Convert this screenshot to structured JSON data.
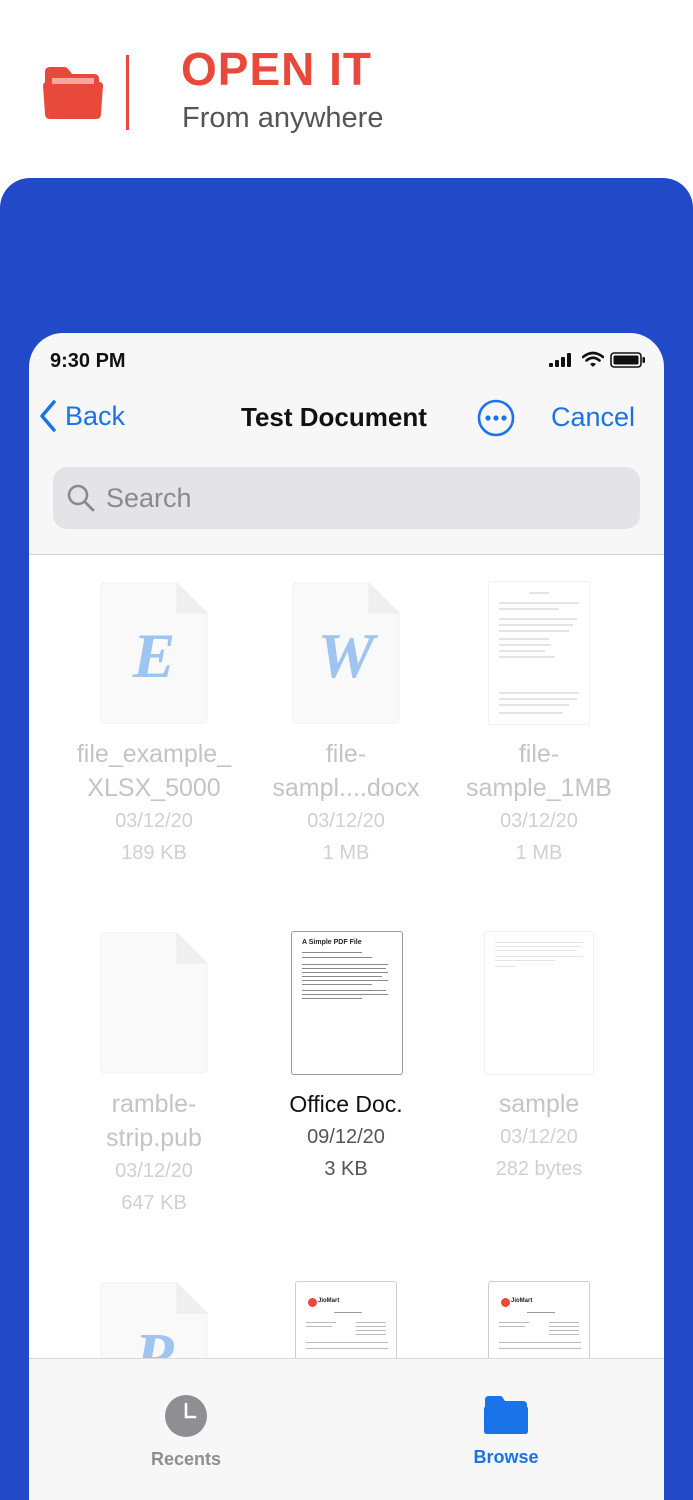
{
  "promo": {
    "headline": "OPEN IT",
    "subline": "From anywhere",
    "accent_color": "#e8493b",
    "panel_color": "#2249c8"
  },
  "status_bar": {
    "time": "9:30 PM",
    "icons": [
      "signal-icon",
      "wifi-icon",
      "battery-icon"
    ]
  },
  "nav": {
    "back_label": "Back",
    "title": "Test Document",
    "more_icon": "ellipsis-circle-icon",
    "cancel_label": "Cancel",
    "link_color": "#1a73e8"
  },
  "search": {
    "placeholder": "Search",
    "value": ""
  },
  "files": [
    {
      "name_line1": "file_example_",
      "name_line2": "XLSX_5000",
      "date": "03/12/20",
      "size": "189 KB",
      "icon": "excel-file-icon",
      "glyph": "E",
      "enabled": false
    },
    {
      "name_line1": "file-",
      "name_line2": "sampl....docx",
      "date": "03/12/20",
      "size": "1 MB",
      "icon": "word-file-icon",
      "glyph": "W",
      "enabled": false
    },
    {
      "name_line1": "file-",
      "name_line2": "sample_1MB",
      "date": "03/12/20",
      "size": "1 MB",
      "icon": "document-thumbnail-icon",
      "enabled": false
    },
    {
      "name_line1": "ramble-",
      "name_line2": "strip.pub",
      "date": "03/12/20",
      "size": "647 KB",
      "icon": "blank-file-icon",
      "enabled": false
    },
    {
      "name_line1": "Office Doc.",
      "name_line2": "",
      "date": "09/12/20",
      "size": "3 KB",
      "icon": "pdf-thumbnail-icon",
      "thumb_title": "A Simple PDF File",
      "enabled": true
    },
    {
      "name_line1": "sample",
      "name_line2": "",
      "date": "03/12/20",
      "size": "282 bytes",
      "icon": "text-thumbnail-icon",
      "enabled": false
    },
    {
      "name_line1": "",
      "name_line2": "",
      "date": "",
      "size": "",
      "icon": "publisher-file-icon",
      "glyph": "P",
      "enabled": false
    },
    {
      "name_line1": "",
      "name_line2": "",
      "date": "",
      "size": "",
      "icon": "invoice-thumbnail-icon",
      "thumb_title": "JioMart",
      "enabled": false
    },
    {
      "name_line1": "",
      "name_line2": "",
      "date": "",
      "size": "",
      "icon": "invoice-thumbnail-icon",
      "thumb_title": "JioMart",
      "enabled": false
    }
  ],
  "tabs": [
    {
      "label": "Recents",
      "icon": "clock-icon",
      "selected": false
    },
    {
      "label": "Browse",
      "icon": "folder-icon",
      "selected": true
    }
  ]
}
